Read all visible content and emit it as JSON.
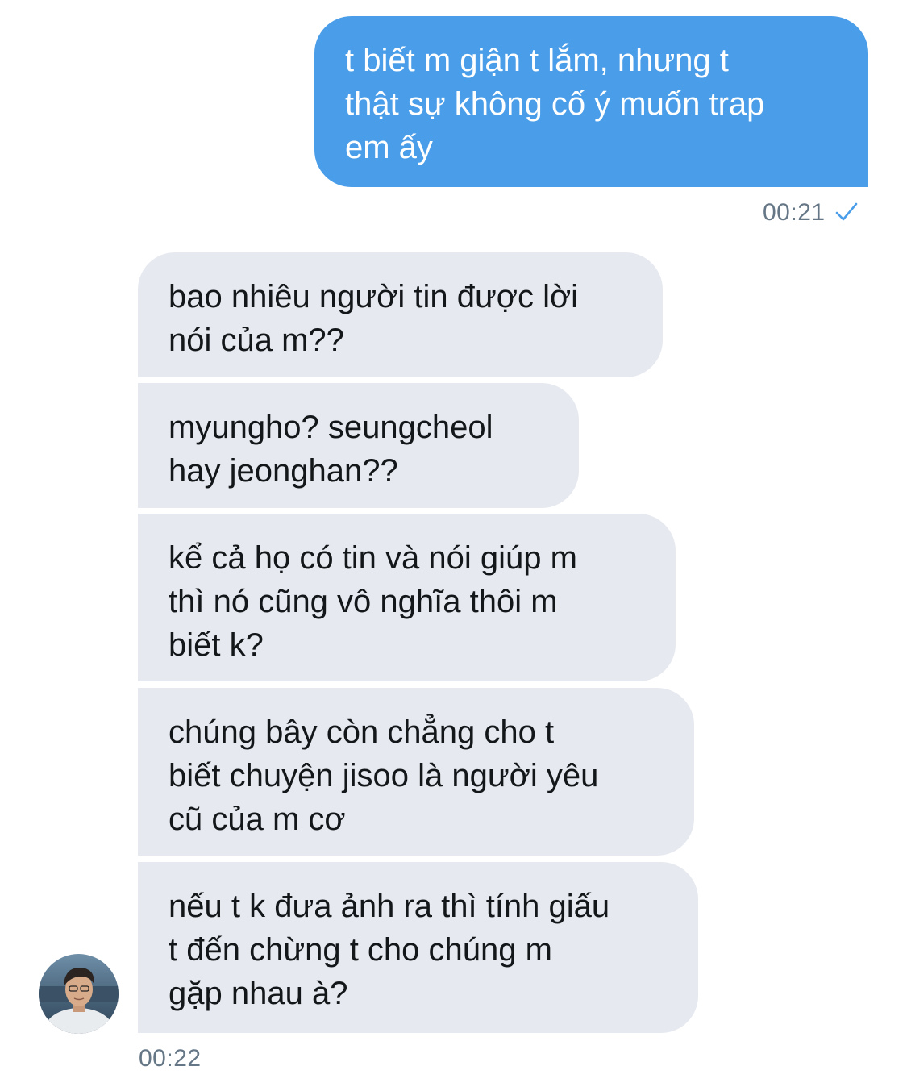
{
  "messages": {
    "outgoing": [
      {
        "text": "t biết m giận t lắm, nhưng t\nthật sự không cố ý muốn trap\nem ấy"
      }
    ],
    "outgoing_time": "00:21",
    "incoming": [
      {
        "text": "bao nhiêu người tin được lời\nnói của m??"
      },
      {
        "text": "myungho? seungcheol\nhay jeonghan??"
      },
      {
        "text": "kể cả họ có tin và nói giúp m\nthì nó cũng vô nghĩa thôi m\nbiết k?"
      },
      {
        "text": "chúng bây còn chẳng cho t\nbiết chuyện jisoo là người yêu\ncũ của m cơ"
      },
      {
        "text": "nếu t k đưa ảnh ra thì tính giấu\nt đến chừng t cho chúng m\ngặp nhau à?"
      }
    ],
    "incoming_time": "00:22"
  },
  "icons": {
    "read_receipt": "checkmark-icon",
    "avatar": "user-avatar"
  },
  "colors": {
    "outgoing_bubble": "#4a9de8",
    "incoming_bubble": "#e6e9ef",
    "timestamp": "#657786",
    "checkmark": "#4a9de8"
  }
}
